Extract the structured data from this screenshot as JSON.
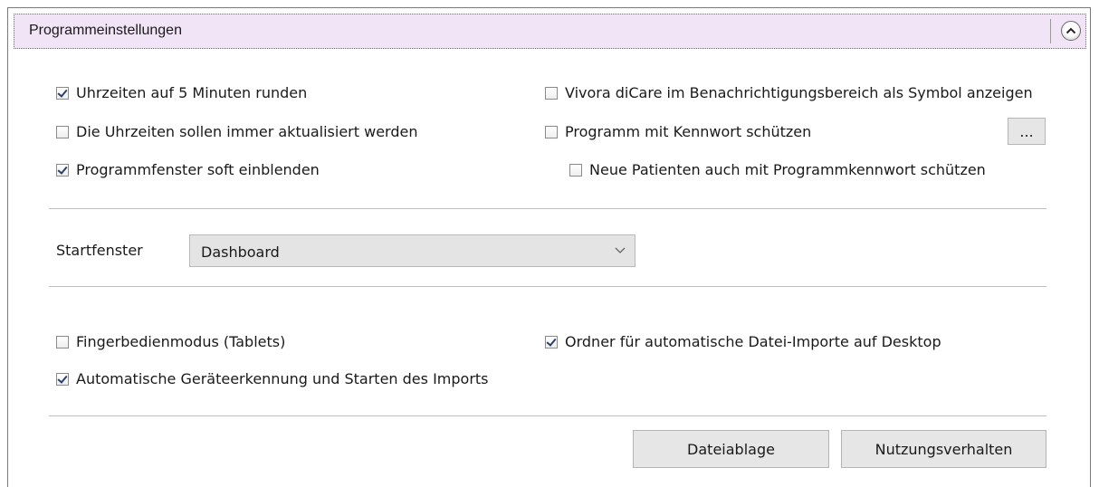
{
  "header": {
    "title": "Programmeinstellungen"
  },
  "options": {
    "round_times": {
      "label": "Uhrzeiten auf 5 Minuten runden",
      "checked": true
    },
    "update_times": {
      "label": "Die Uhrzeiten sollen immer aktualisiert werden",
      "checked": false
    },
    "soft_fade": {
      "label": "Programmfenster soft einblenden",
      "checked": true
    },
    "tray_icon": {
      "label": "Vivora diCare im Benachrichtigungsbereich als Symbol anzeigen",
      "checked": false
    },
    "password_protect": {
      "label": "Programm mit Kennwort schützen",
      "checked": false
    },
    "new_patients_password": {
      "label": "Neue Patienten auch mit Programmkennwort schützen",
      "checked": false
    },
    "finger_mode": {
      "label": "Fingerbedienmodus (Tablets)",
      "checked": false
    },
    "auto_import_folder": {
      "label": "Ordner für automatische Datei-Importe auf Desktop",
      "checked": true
    },
    "auto_device_detect": {
      "label": "Automatische Geräteerkennung und Starten des Imports",
      "checked": true
    }
  },
  "password_button": {
    "label": "..."
  },
  "startfenster": {
    "label": "Startfenster",
    "value": "Dashboard"
  },
  "buttons": {
    "file_storage": "Dateiablage",
    "usage_behavior": "Nutzungsverhalten"
  }
}
